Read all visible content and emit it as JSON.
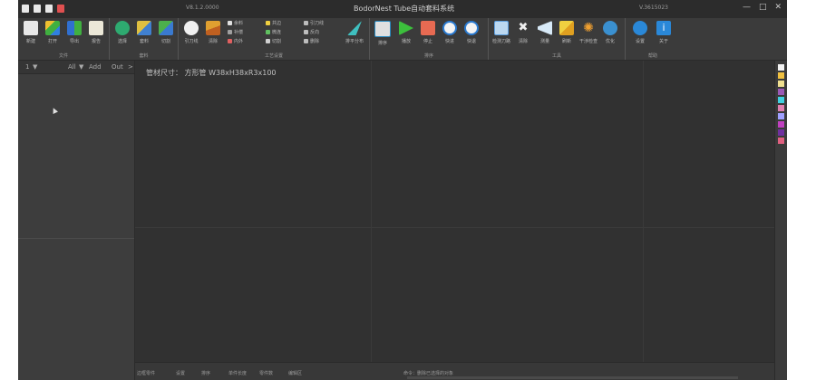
{
  "window": {
    "title": "BodorNest Tube自动套料系统",
    "version_left": "V8.1.2.0000",
    "version_right": "V.3615023",
    "controls": [
      "—",
      "□",
      "✕"
    ]
  },
  "ribbon": {
    "file": {
      "title": "文件",
      "buttons": [
        "新建",
        "打开",
        "导出",
        "报告"
      ]
    },
    "nest": {
      "title": "套料",
      "buttons": [
        "选择",
        "套料",
        "切割"
      ]
    },
    "craft": {
      "title": "工艺设置",
      "big": [
        "引刀线",
        "清除"
      ],
      "small": [
        "余料",
        "补偿",
        "内外",
        "共边",
        "微连",
        "切割",
        "引刀线",
        "反向",
        "删除"
      ],
      "extra_button": "排平分布"
    },
    "sort": {
      "title": "排序",
      "buttons": [
        "排序",
        "播放",
        "停止",
        "快进",
        "快退"
      ]
    },
    "tools": {
      "title": "工具",
      "buttons": [
        "检测刀路",
        "清除",
        "测量",
        "刷新",
        "干涉检查",
        "优化"
      ]
    },
    "help": {
      "title": "帮助",
      "buttons": [
        "设置",
        "关于"
      ]
    }
  },
  "left_panel": {
    "toolbar": [
      "1",
      "▼",
      "All",
      "▼",
      "Add",
      "Out",
      ">"
    ]
  },
  "canvas": {
    "info_label": "管材尺寸：",
    "info_value": "方形管  W38xH38xR3x100"
  },
  "bottom_bar": {
    "items": [
      "边框零件",
      "设置",
      "排序",
      "单件长度",
      "零件数",
      "编辑区"
    ],
    "status": "命令：删除已选择的对象"
  },
  "palette": [
    "#f2f2f2",
    "#f0c040",
    "#f0e090",
    "#9b59b6",
    "#40d0e0",
    "#e080b0",
    "#a0a0ff",
    "#c040c0",
    "#7030a0",
    "#e06080"
  ]
}
